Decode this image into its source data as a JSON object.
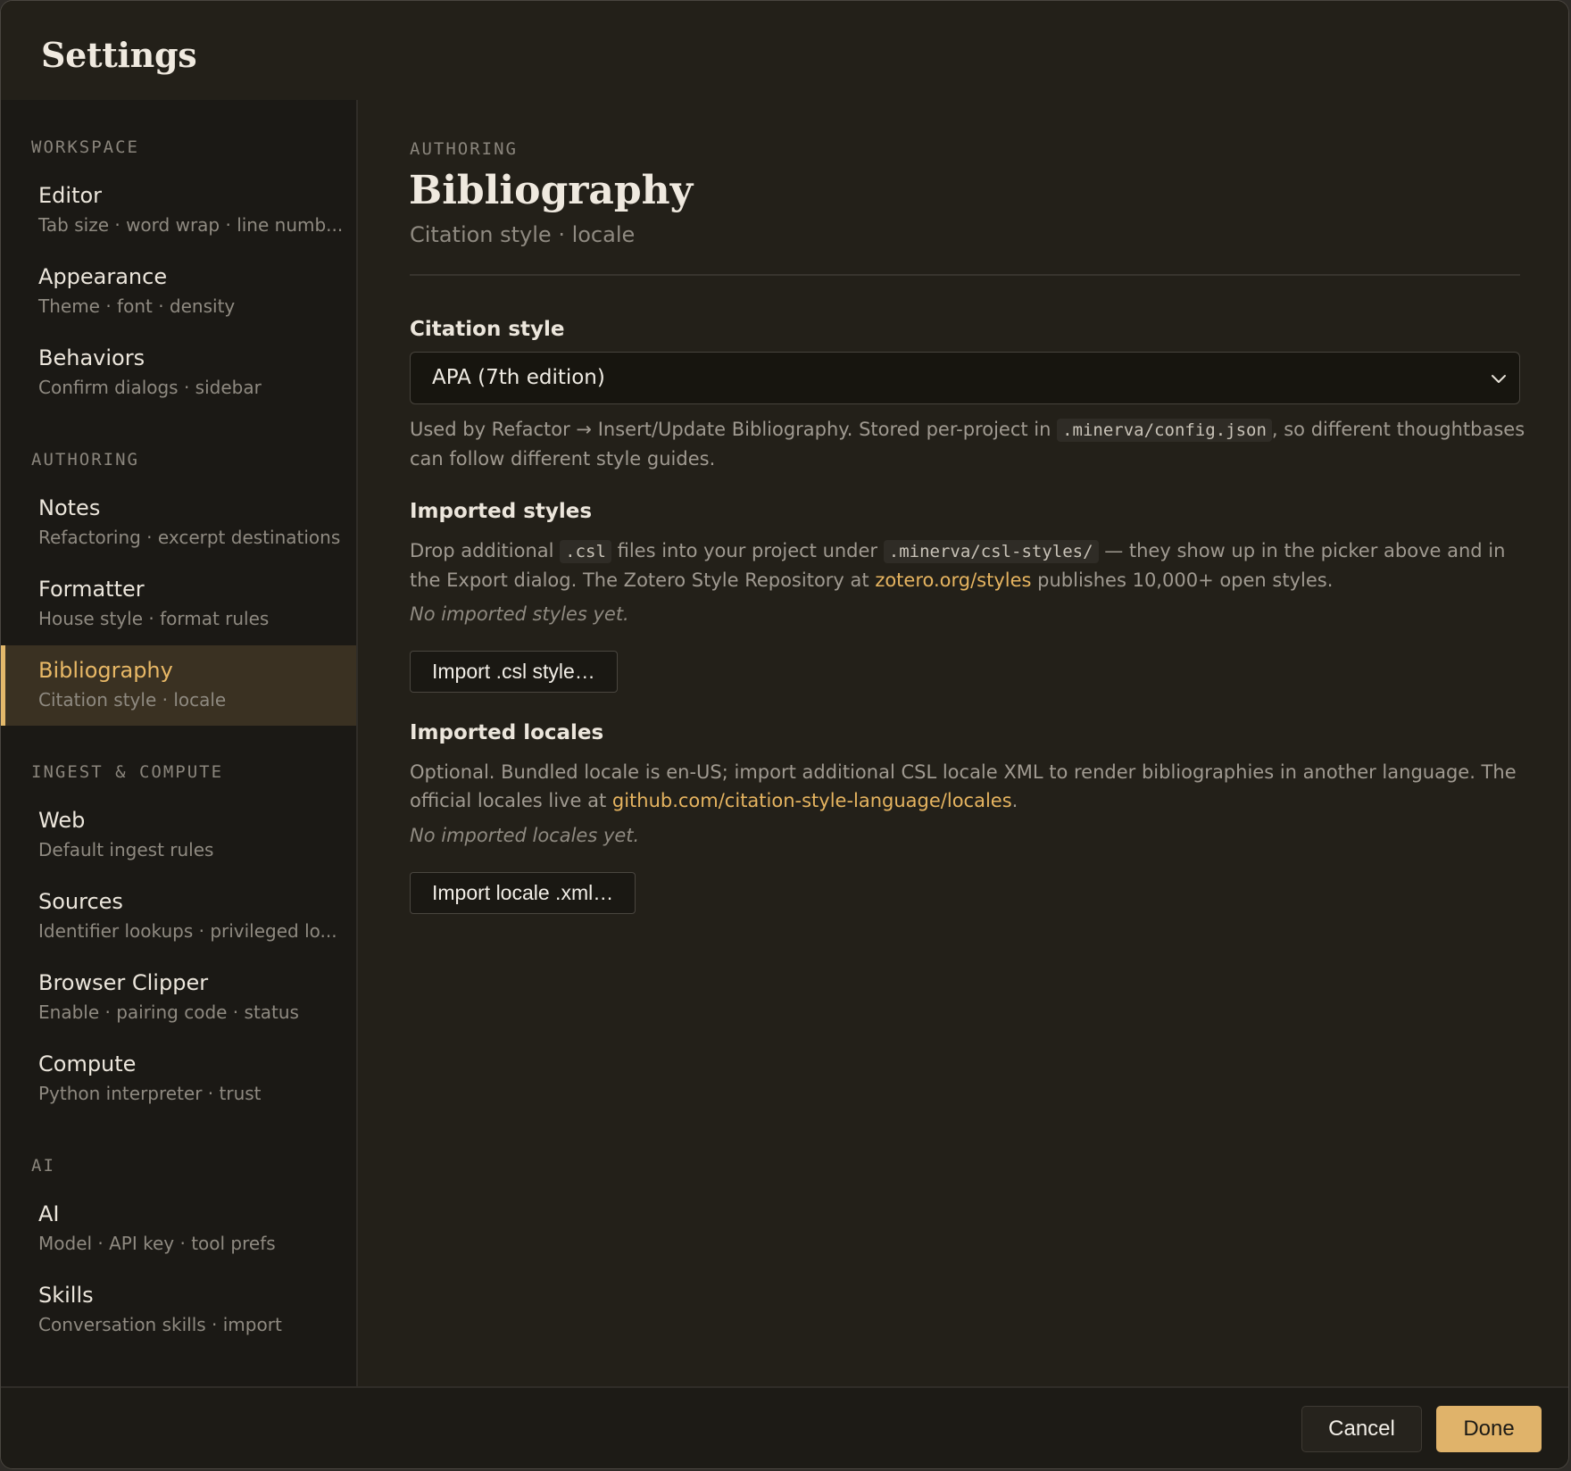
{
  "window": {
    "title": "Settings"
  },
  "sidebar": {
    "sections": [
      {
        "label": "WORKSPACE",
        "items": [
          {
            "title": "Editor",
            "subtitle": "Tab size · word wrap · line numb..."
          },
          {
            "title": "Appearance",
            "subtitle": "Theme · font · density"
          },
          {
            "title": "Behaviors",
            "subtitle": "Confirm dialogs · sidebar"
          }
        ]
      },
      {
        "label": "AUTHORING",
        "items": [
          {
            "title": "Notes",
            "subtitle": "Refactoring · excerpt destinations"
          },
          {
            "title": "Formatter",
            "subtitle": "House style · format rules"
          },
          {
            "title": "Bibliography",
            "subtitle": "Citation style · locale"
          }
        ]
      },
      {
        "label": "INGEST & COMPUTE",
        "items": [
          {
            "title": "Web",
            "subtitle": "Default ingest rules"
          },
          {
            "title": "Sources",
            "subtitle": "Identifier lookups · privileged lo..."
          },
          {
            "title": "Browser Clipper",
            "subtitle": "Enable · pairing code · status"
          },
          {
            "title": "Compute",
            "subtitle": "Python interpreter · trust"
          }
        ]
      },
      {
        "label": "AI",
        "items": [
          {
            "title": "AI",
            "subtitle": "Model · API key · tool prefs"
          },
          {
            "title": "Skills",
            "subtitle": "Conversation skills · import"
          }
        ]
      }
    ],
    "active_item": "Bibliography"
  },
  "main": {
    "eyebrow": "AUTHORING",
    "title": "Bibliography",
    "subtitle": "Citation style · locale",
    "citation": {
      "label": "Citation style",
      "value": "APA (7th edition)",
      "help_1": "Used by Refactor → Insert/Update Bibliography. Stored per-project in ",
      "help_code": ".minerva/config.json",
      "help_2": ", so different thoughtbases can follow different style guides."
    },
    "styles": {
      "label": "Imported styles",
      "desc_1": "Drop additional ",
      "desc_code_1": ".csl",
      "desc_2": " files into your project under ",
      "desc_code_2": ".minerva/csl-styles/",
      "desc_3": " — they show up in the picker above and in the Export dialog. The Zotero Style Repository at ",
      "desc_link": "zotero.org/styles",
      "desc_4": " publishes 10,000+ open styles.",
      "empty": "No imported styles yet.",
      "button": "Import .csl style…"
    },
    "locales": {
      "label": "Imported locales",
      "desc_1": "Optional. Bundled locale is en-US; import additional CSL locale XML to render bibliographies in another language. The official locales live at ",
      "desc_link": "github.com/citation-style-language/locales",
      "desc_2": ".",
      "empty": "No imported locales yet.",
      "button": "Import locale .xml…"
    }
  },
  "footer": {
    "cancel": "Cancel",
    "done": "Done"
  },
  "colors": {
    "accent": "#e0b36a",
    "background": "#232019",
    "sidebar": "#1b1915"
  }
}
